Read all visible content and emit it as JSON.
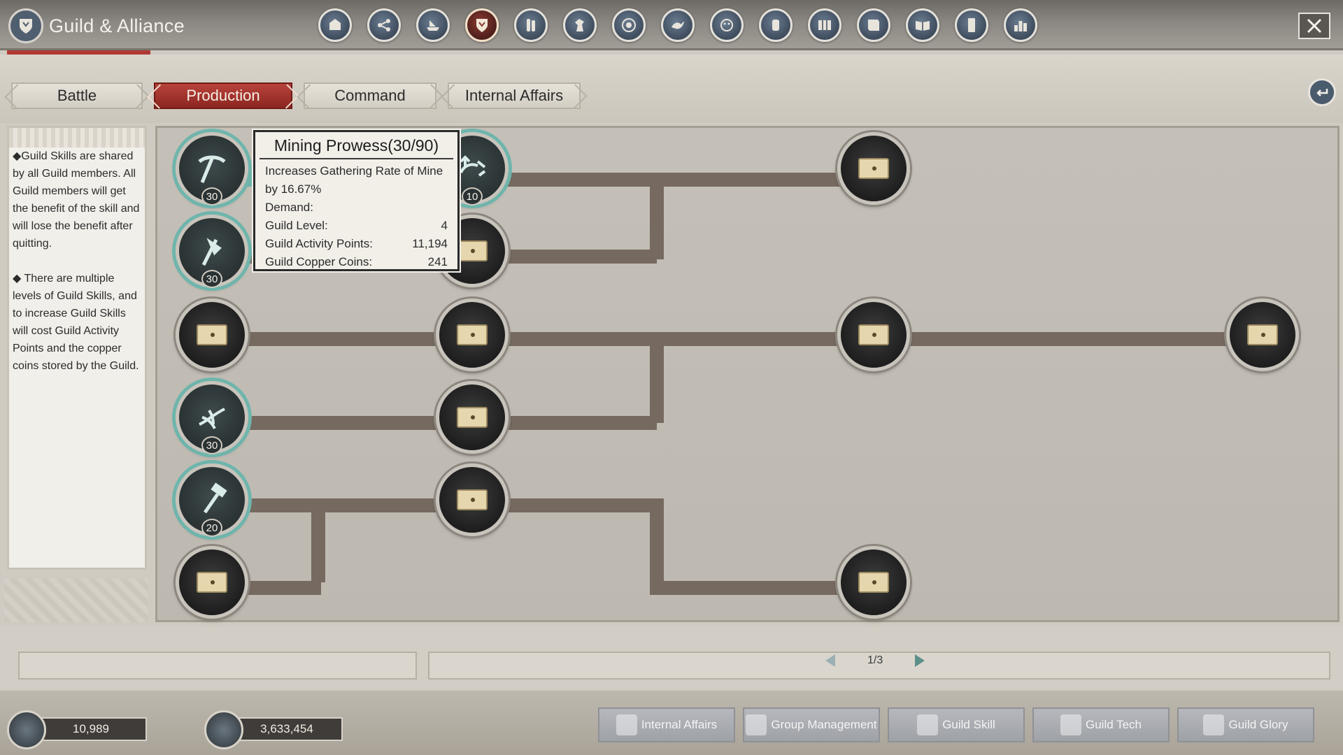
{
  "window": {
    "title": "Guild & Alliance"
  },
  "top_nav": {
    "icons": [
      "guild-hall-icon",
      "network-icon",
      "ship-icon",
      "guild-shield-icon",
      "scroll-icon",
      "horse-icon",
      "target-icon",
      "dragon-icon",
      "face-icon",
      "seal-icon",
      "map-icon",
      "book-icon",
      "open-book-icon",
      "tablet-icon",
      "ranking-icon"
    ],
    "active_index": 3
  },
  "tabs": [
    {
      "label": "Battle",
      "active": false
    },
    {
      "label": "Production",
      "active": true
    },
    {
      "label": "Command",
      "active": false
    },
    {
      "label": "Internal Affairs",
      "active": false
    }
  ],
  "info": {
    "para1": "◆Guild Skills are shared by all Guild members. All Guild members will get the benefit of the skill and will lose the benefit after quitting.",
    "para2": "◆ There are multiple levels of Guild Skills, and to increase Guild Skills will cost Guild Activity Points and the copper coins stored by the Guild."
  },
  "tooltip": {
    "title": "Mining Prowess(30/90)",
    "description": "Increases Gathering Rate of Mine by 16.67%",
    "demand_label": "Demand:",
    "rows": [
      {
        "label": "Guild Level:",
        "value": "4"
      },
      {
        "label": "Guild Activity Points:",
        "value": "11,194"
      },
      {
        "label": "Guild Copper Coins:",
        "value": "241"
      }
    ]
  },
  "nodes": [
    {
      "id": "mining",
      "level": "30",
      "unlocked": true,
      "icon": "pickaxe-icon"
    },
    {
      "id": "lumber",
      "level": "30",
      "unlocked": true,
      "icon": "axe-icon"
    },
    {
      "id": "r3c1",
      "level": "",
      "unlocked": false,
      "icon": "locked-icon"
    },
    {
      "id": "fishing",
      "level": "30",
      "unlocked": true,
      "icon": "grain-icon"
    },
    {
      "id": "hammer",
      "level": "20",
      "unlocked": true,
      "icon": "hammer-icon"
    },
    {
      "id": "r6c1",
      "level": "",
      "unlocked": false,
      "icon": "locked-icon"
    },
    {
      "id": "r1c2",
      "level": "10",
      "unlocked": true,
      "icon": "upgrade-icon"
    },
    {
      "id": "r2c2",
      "level": "",
      "unlocked": false,
      "icon": "locked-icon"
    },
    {
      "id": "r3c2",
      "level": "",
      "unlocked": false,
      "icon": "locked-icon"
    },
    {
      "id": "r4c2",
      "level": "",
      "unlocked": false,
      "icon": "locked-icon"
    },
    {
      "id": "r5c2",
      "level": "",
      "unlocked": false,
      "icon": "locked-icon"
    },
    {
      "id": "r1c3",
      "level": "",
      "unlocked": false,
      "icon": "locked-icon"
    },
    {
      "id": "r3c3",
      "level": "",
      "unlocked": false,
      "icon": "locked-icon"
    },
    {
      "id": "r6c3",
      "level": "",
      "unlocked": false,
      "icon": "locked-icon"
    },
    {
      "id": "r3c4",
      "level": "",
      "unlocked": false,
      "icon": "locked-icon"
    }
  ],
  "pager": {
    "text": "1/3"
  },
  "currencies": [
    {
      "icon": "coins-icon",
      "value": "10,989"
    },
    {
      "icon": "silver-icon",
      "value": "3,633,454"
    }
  ],
  "bottom_tabs": [
    {
      "label": "Internal Affairs",
      "icon": "banner-icon"
    },
    {
      "label": "Group Management",
      "icon": "people-icon"
    },
    {
      "label": "Guild Skill",
      "icon": "skill-tree-icon"
    },
    {
      "label": "Guild Tech",
      "icon": "tech-icon"
    },
    {
      "label": "Guild Glory",
      "icon": "glory-icon"
    }
  ]
}
